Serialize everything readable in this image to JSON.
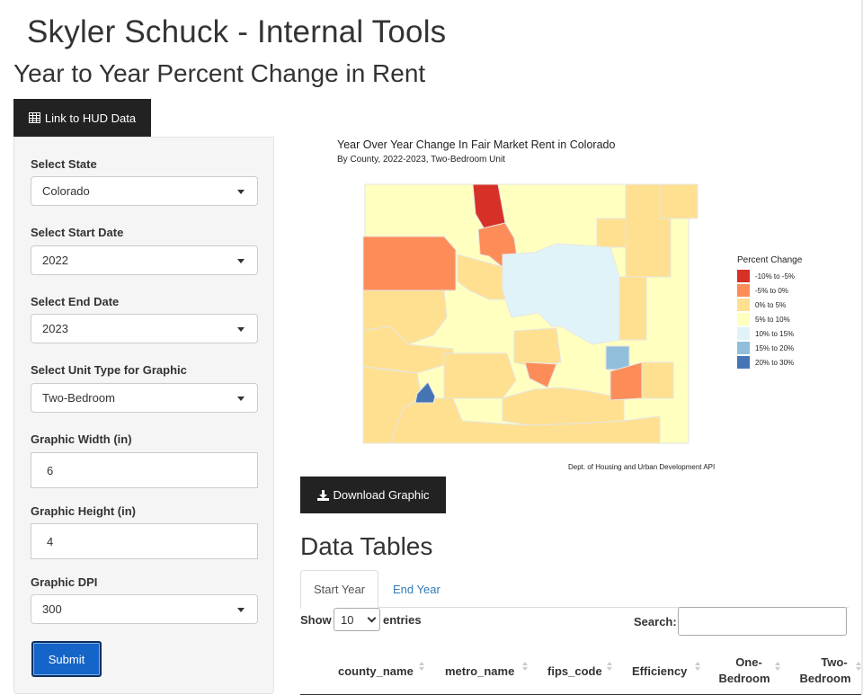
{
  "app_title": "Skyler Schuck - Internal Tools",
  "page_title": "Year to Year Percent Change in Rent",
  "hud_button": {
    "label": "Link to HUD Data",
    "icon": "table-icon"
  },
  "sidebar": {
    "state": {
      "label": "Select State",
      "value": "Colorado"
    },
    "start_date": {
      "label": "Select Start Date",
      "value": "2022"
    },
    "end_date": {
      "label": "Select End Date",
      "value": "2023"
    },
    "unit_type": {
      "label": "Select Unit Type for Graphic",
      "value": "Two-Bedroom"
    },
    "width": {
      "label": "Graphic Width (in)",
      "value": "6"
    },
    "height": {
      "label": "Graphic Height (in)",
      "value": "4"
    },
    "dpi": {
      "label": "Graphic DPI",
      "value": "300"
    },
    "submit_label": "Submit"
  },
  "map": {
    "title": "Year Over Year Change In Fair Market Rent in Colorado",
    "subtitle": "By County, 2022-2023, Two-Bedroom Unit",
    "caption": "Dept. of Housing and Urban Development API",
    "legend_title": "Percent Change",
    "legend": [
      {
        "label": "-10% to -5%",
        "color": "#d73027"
      },
      {
        "label": "-5% to 0%",
        "color": "#fc8d59"
      },
      {
        "label": "0% to 5%",
        "color": "#fee090"
      },
      {
        "label": "5% to 10%",
        "color": "#ffffbf"
      },
      {
        "label": "10% to 15%",
        "color": "#e0f3f8"
      },
      {
        "label": "15% to 20%",
        "color": "#91bfdb"
      },
      {
        "label": "20% to 30%",
        "color": "#4575b4"
      }
    ]
  },
  "download_button": {
    "label": "Download Graphic",
    "icon": "download-icon"
  },
  "data_tables": {
    "title": "Data Tables",
    "tabs": [
      "Start Year",
      "End Year"
    ],
    "show_label": "Show",
    "entries_value": "10",
    "entries_label": "entries",
    "search_label": "Search:",
    "columns": [
      "county_name",
      "metro_name",
      "fips_code",
      "Efficiency",
      "One-",
      "Bedroom",
      "Two-",
      "Bedroom"
    ]
  }
}
